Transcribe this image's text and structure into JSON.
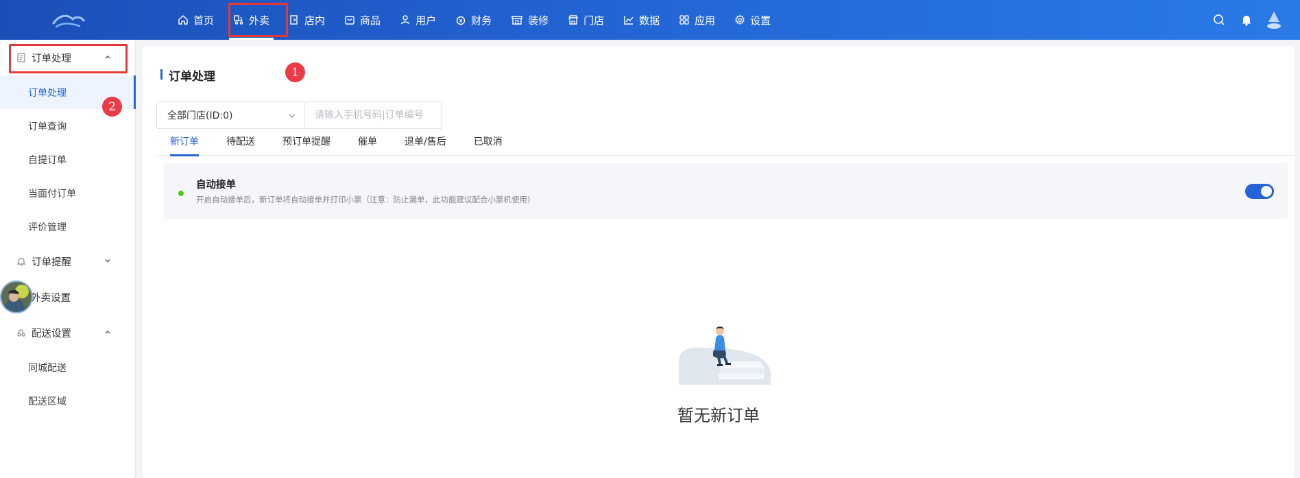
{
  "nav": {
    "items": [
      {
        "label": "首页",
        "icon": "home-icon"
      },
      {
        "label": "外卖",
        "icon": "takeout-icon"
      },
      {
        "label": "店内",
        "icon": "store-in-icon"
      },
      {
        "label": "商品",
        "icon": "goods-icon"
      },
      {
        "label": "用户",
        "icon": "user-icon"
      },
      {
        "label": "财务",
        "icon": "finance-icon"
      },
      {
        "label": "装修",
        "icon": "decorate-icon"
      },
      {
        "label": "门店",
        "icon": "shop-icon"
      },
      {
        "label": "数据",
        "icon": "chart-icon"
      },
      {
        "label": "应用",
        "icon": "apps-icon"
      },
      {
        "label": "设置",
        "icon": "gear-icon"
      }
    ],
    "active": "外卖"
  },
  "sidebar": {
    "groups": [
      {
        "label": "订单处理",
        "icon": "document-icon",
        "expanded": true,
        "items": [
          "订单处理",
          "订单查询",
          "自提订单",
          "当面付订单",
          "评价管理"
        ]
      },
      {
        "label": "订单提醒",
        "icon": "bell-outline-icon",
        "expanded": false,
        "items": []
      },
      {
        "label": "外卖设置",
        "icon": "settings-icon",
        "expanded": false,
        "items": []
      },
      {
        "label": "配送设置",
        "icon": "delivery-icon",
        "expanded": true,
        "items": [
          "同城配送",
          "配送区域"
        ]
      }
    ],
    "active_item": "订单处理"
  },
  "annotations": {
    "badge1": "1",
    "badge2": "2"
  },
  "main": {
    "title": "订单处理",
    "store_select": "全部门店(ID:0)",
    "search_placeholder": "请输入手机号码|订单编号",
    "tabs": [
      "新订单",
      "待配送",
      "预订单提醒",
      "催单",
      "退单/售后",
      "已取消"
    ],
    "active_tab": "新订单",
    "auto_accept": {
      "title": "自动接单",
      "desc": "开启自动接单后，新订单将自动接单并打印小票（注意：防止漏单，此功能建议配合小票机使用)",
      "enabled": true
    },
    "empty_text": "暂无新订单"
  },
  "colors": {
    "primary": "#2563d6",
    "highlight": "#e53935",
    "badge": "#ea3b46",
    "status_dot": "#52c41a"
  }
}
